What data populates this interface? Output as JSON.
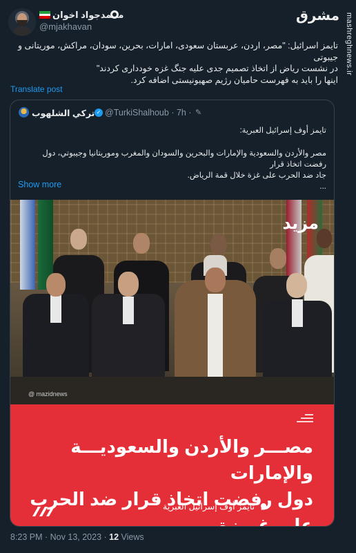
{
  "author": {
    "display_name": "محمدجواد اخوان",
    "handle": "@mjakhavan",
    "flag_colors": [
      "#239f40",
      "#ffffff",
      "#da0000"
    ]
  },
  "watermark": {
    "logo_text": "مشرق",
    "url": "mashreghnews.ir"
  },
  "tweet": {
    "lines": [
      "تایمز اسرائیل: \"مصر، اردن، عربستان سعودی، امارات، بحرین، سودان، مراکش، موریتانی و جیبوتی",
      "در نشست ریاض از اتخاذ تصمیم جدی علیه جنگ غزه خودداری کردند\"",
      "اینها را باید به فهرست حامیان رژیم صهیونیستی اضافه کرد."
    ],
    "translate_label": "Translate post"
  },
  "quote": {
    "name": "تركي الشلهوب",
    "handle": "@TurkiShalhoub",
    "time": "· 7h ·",
    "edit_icon": "pencil-icon",
    "source_line": "تايمز أوف إسرائيل العبرية:",
    "body_lines": [
      "مصر والأردن والسعودية والإمارات والبحرين والسودان والمغرب وموريتانيا وجيبوتي، دول رفضت اتخاذ قرار",
      "جاد ضد الحرب على غزة خلال قمة الرياض.",
      "..."
    ],
    "show_more": "Show more",
    "photo": {
      "logo_text": "مزید",
      "credit": "@ mazidnews"
    },
    "banner": {
      "headline_line1": "مصـــر والأردن والسعوديـــة والإمارات",
      "headline_line2": "دول رفضت اتخاذ قرار ضد الحرب على غـــزة",
      "source": "تايمز أوف إسرائيل العبرية",
      "color": "#e52f38"
    }
  },
  "footer": {
    "time": "8:23 PM · Nov 13, 2023 · ",
    "views_count": "12",
    "views_label": " Views"
  }
}
